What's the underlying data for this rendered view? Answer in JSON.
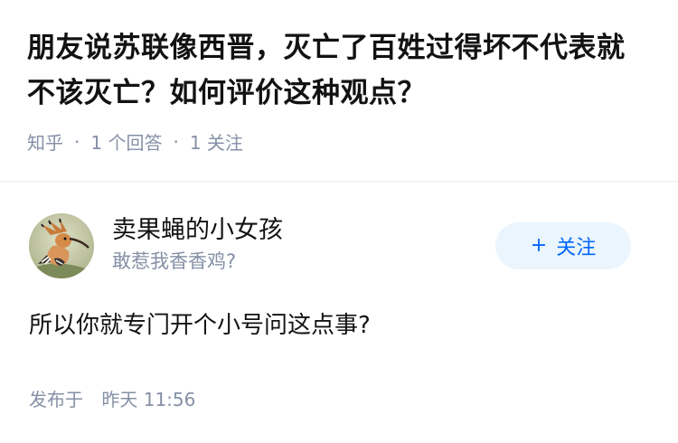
{
  "question": {
    "title": "朋友说苏联像西晋，灭亡了百姓过得坏不代表就不该灭亡？如何评价这种观点？",
    "site": "知乎",
    "answers": "1 个回答",
    "followers": "1 关注",
    "separator": "·"
  },
  "answer": {
    "author_name": "卖果蝇的小女孩",
    "author_bio": "敢惹我香香鸡?",
    "follow_label": "关注",
    "follow_plus": "+",
    "content": "所以你就专门开个小号问这点事?",
    "time_prefix": "发布于",
    "time": "昨天 11:56"
  },
  "colors": {
    "primary_blue": "#0066ff",
    "button_bg": "#ebf5fd",
    "meta_gray": "#8590a6",
    "text_dark": "#121212"
  },
  "icons": {
    "avatar": "hoopoe-bird-avatar",
    "follow": "plus-icon"
  }
}
